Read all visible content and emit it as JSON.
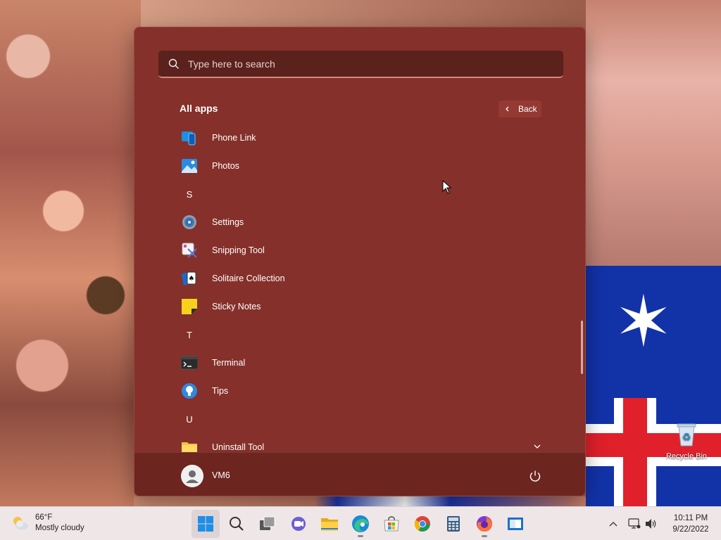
{
  "start_menu": {
    "search_placeholder": "Type here to search",
    "section_title": "All apps",
    "back_label": "Back",
    "apps": [
      {
        "type": "app",
        "label": "Phone Link",
        "icon": "phone-link-icon"
      },
      {
        "type": "app",
        "label": "Photos",
        "icon": "photos-icon"
      },
      {
        "type": "letter",
        "label": "S"
      },
      {
        "type": "app",
        "label": "Settings",
        "icon": "settings-gear-icon"
      },
      {
        "type": "app",
        "label": "Snipping Tool",
        "icon": "snipping-tool-icon"
      },
      {
        "type": "app",
        "label": "Solitaire Collection",
        "icon": "solitaire-cards-icon"
      },
      {
        "type": "app",
        "label": "Sticky Notes",
        "icon": "sticky-notes-icon"
      },
      {
        "type": "letter",
        "label": "T"
      },
      {
        "type": "app",
        "label": "Terminal",
        "icon": "terminal-icon"
      },
      {
        "type": "app",
        "label": "Tips",
        "icon": "tips-lightbulb-icon"
      },
      {
        "type": "letter",
        "label": "U"
      },
      {
        "type": "app",
        "label": "Uninstall Tool",
        "icon": "folder-icon"
      }
    ],
    "user_name": "VM6"
  },
  "desktop": {
    "recycle_bin_label": "Recycle Bin"
  },
  "taskbar": {
    "weather_temp": "66°F",
    "weather_desc": "Mostly cloudy",
    "clock_time": "10:11 PM",
    "clock_date": "9/22/2022",
    "pinned": [
      "start-icon",
      "search-icon",
      "task-view-icon",
      "chat-icon",
      "file-explorer-icon",
      "edge-icon",
      "store-icon",
      "chrome-icon",
      "calculator-icon",
      "firefox-icon",
      "app-icon"
    ]
  },
  "colors": {
    "start_bg": "#85302a",
    "footer_bg": "#6d2520",
    "taskbar_bg": "#efe6e8"
  }
}
